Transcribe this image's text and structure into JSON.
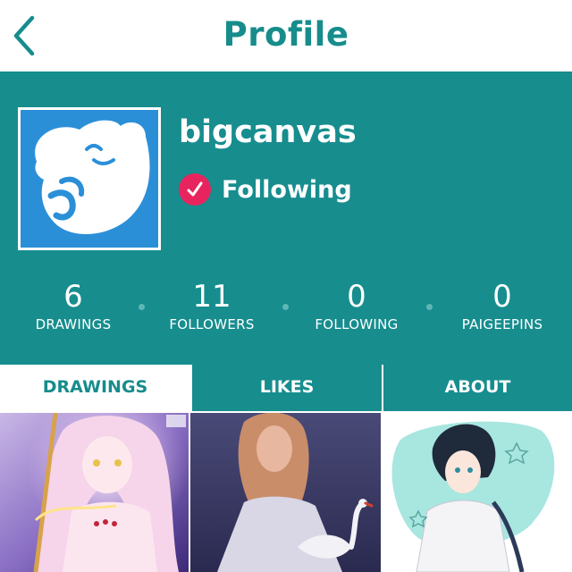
{
  "nav": {
    "title": "Profile"
  },
  "profile": {
    "username": "bigcanvas",
    "follow_status": "Following"
  },
  "stats": [
    {
      "value": "6",
      "label": "DRAWINGS"
    },
    {
      "value": "11",
      "label": "FOLLOWERS"
    },
    {
      "value": "0",
      "label": "FOLLOWING"
    },
    {
      "value": "0",
      "label": "PAIGEEPINS"
    }
  ],
  "tabs": [
    {
      "label": "DRAWINGS",
      "active": true
    },
    {
      "label": "LIKES",
      "active": false
    },
    {
      "label": "ABOUT",
      "active": false
    }
  ],
  "gallery": {
    "items": [
      {
        "icon": "drawing-angel-girl"
      },
      {
        "icon": "drawing-swan-girl"
      },
      {
        "icon": "drawing-dark-haired-boy"
      }
    ]
  },
  "colors": {
    "accent": "#178c8c",
    "header_bg": "#178d8e",
    "avatar_bg": "#2b8fd8",
    "check_badge": "#e8245e"
  }
}
